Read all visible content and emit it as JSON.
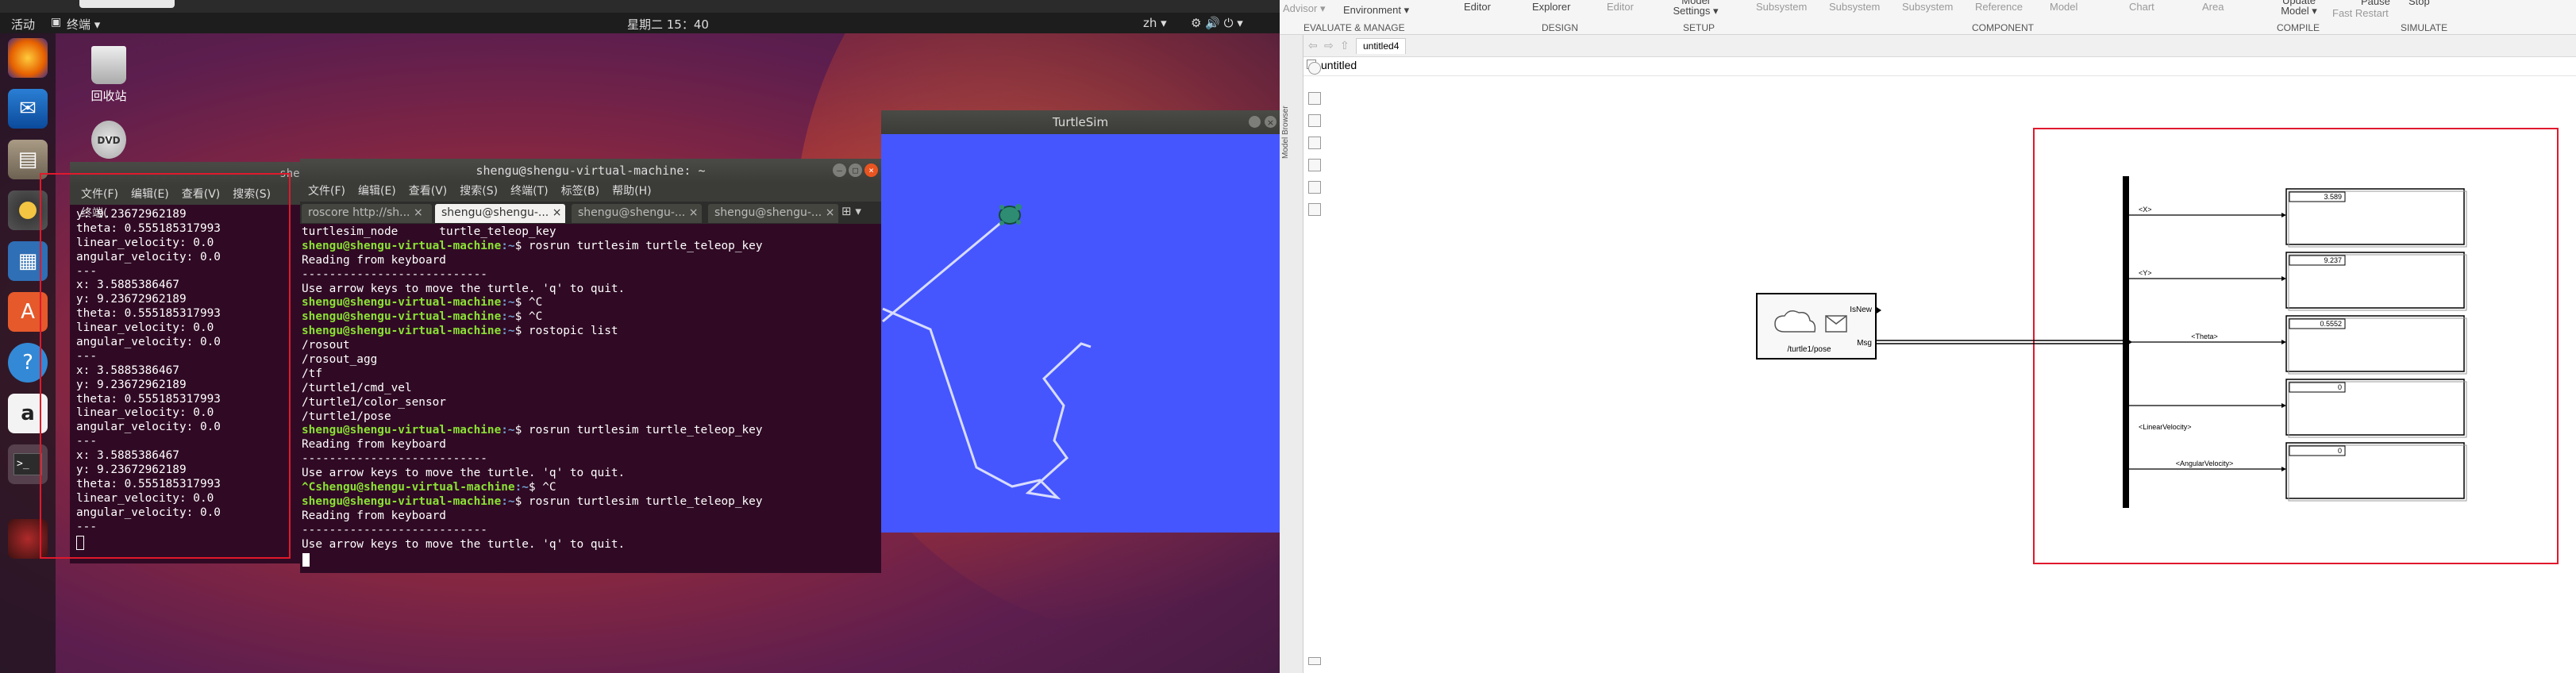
{
  "topbar": {
    "activities": "活动",
    "app_menu": "终端 ▾",
    "clock": "星期二 15：40",
    "input_method": "zh ▾",
    "system_icons": "⚙ 🔊 ⏻ ▾"
  },
  "desktop": {
    "trash_label": "回收站",
    "dvd_label": "DVD"
  },
  "dock": {
    "items": [
      "firefox-icon",
      "thunderbird-icon",
      "files-icon",
      "rhythmbox-icon",
      "writer-icon",
      "software-icon",
      "help-icon",
      "amazon-icon",
      "terminal-icon",
      "ros-icon"
    ]
  },
  "term_back": {
    "title_fragment": "shen",
    "menu": [
      "文件(F)",
      "编辑(E)",
      "查看(V)",
      "搜索(S)",
      "终端("
    ],
    "lines": [
      "y: 9.23672962189",
      "theta: 0.555185317993",
      "linear_velocity: 0.0",
      "angular_velocity: 0.0",
      "---",
      "x: 3.5885386467",
      "y: 9.23672962189",
      "theta: 0.555185317993",
      "linear_velocity: 0.0",
      "angular_velocity: 0.0",
      "---",
      "x: 3.5885386467",
      "y: 9.23672962189",
      "theta: 0.555185317993",
      "linear_velocity: 0.0",
      "angular_velocity: 0.0",
      "---",
      "x: 3.5885386467",
      "y: 9.23672962189",
      "theta: 0.555185317993",
      "linear_velocity: 0.0",
      "angular_velocity: 0.0",
      "---"
    ]
  },
  "term_front": {
    "title": "shengu@shengu-virtual-machine: ~",
    "menu": [
      "文件(F)",
      "编辑(E)",
      "查看(V)",
      "搜索(S)",
      "终端(T)",
      "标签(B)",
      "帮助(H)"
    ],
    "tabs": [
      "roscore http://sh...",
      "shengu@shengu-...",
      "shengu@shengu-...",
      "shengu@shengu-..."
    ],
    "prompt_user": "shengu@shengu-virtual-machine",
    "lines": [
      {
        "p": "",
        "t": "turtlesim_node      turtle_teleop_key"
      },
      {
        "p": "shengu@shengu-virtual-machine",
        "t": ":~$ rosrun turtlesim turtle_teleop_key"
      },
      {
        "p": "",
        "t": "Reading from keyboard"
      },
      {
        "p": "",
        "t": "---------------------------"
      },
      {
        "p": "",
        "t": "Use arrow keys to move the turtle. 'q' to quit."
      },
      {
        "p": "shengu@shengu-virtual-machine",
        "t": ":~$ ^C"
      },
      {
        "p": "shengu@shengu-virtual-machine",
        "t": ":~$ ^C"
      },
      {
        "p": "shengu@shengu-virtual-machine",
        "t": ":~$ rostopic list"
      },
      {
        "p": "",
        "t": "/rosout"
      },
      {
        "p": "",
        "t": "/rosout_agg"
      },
      {
        "p": "",
        "t": "/tf"
      },
      {
        "p": "",
        "t": "/turtle1/cmd_vel"
      },
      {
        "p": "",
        "t": "/turtle1/color_sensor"
      },
      {
        "p": "",
        "t": "/turtle1/pose"
      },
      {
        "p": "shengu@shengu-virtual-machine",
        "t": ":~$ rosrun turtlesim turtle_teleop_key"
      },
      {
        "p": "",
        "t": "Reading from keyboard"
      },
      {
        "p": "",
        "t": "---------------------------"
      },
      {
        "p": "",
        "t": "Use arrow keys to move the turtle. 'q' to quit."
      },
      {
        "p": "^Cshengu@shengu-virtual-machine",
        "t": ":~$ ^C"
      },
      {
        "p": "shengu@shengu-virtual-machine",
        "t": ":~$ rosrun turtlesim turtle_teleop_key"
      },
      {
        "p": "",
        "t": "Reading from keyboard"
      },
      {
        "p": "",
        "t": "---------------------------"
      },
      {
        "p": "",
        "t": "Use arrow keys to move the turtle. 'q' to quit."
      }
    ]
  },
  "turtlesim": {
    "title": "TurtleSim",
    "background": "#4556ff"
  },
  "matlab": {
    "toolstrip": {
      "advisor": "Advisor ▾",
      "environment": "Environment ▾",
      "editor": "Editor",
      "explorer": "Explorer",
      "editor2": "Editor",
      "model_settings": "Model Settings ▾",
      "subsystem1": "Subsystem",
      "subsystem2": "Subsystem",
      "subsystem3": "Subsystem",
      "reference": "Reference",
      "model": "Model",
      "chart": "Chart",
      "area": "Area",
      "update_model": "Update Model ▾",
      "pause": "Pause",
      "stop": "Stop",
      "fast_restart": "Fast Restart"
    },
    "sections": [
      "EVALUATE & MANAGE",
      "DESIGN",
      "SETUP",
      "COMPONENT",
      "COMPILE",
      "SIMULATE"
    ],
    "tab_name": "untitled4",
    "breadcrumb": "untitled",
    "model_browser": "Model Browser",
    "block_subscribe": {
      "topic": "/turtle1/pose",
      "port_isnew": "IsNew",
      "port_msg": "Msg"
    },
    "bus_signals": [
      "<X>",
      "<Y>",
      "<Theta>",
      "<LinearVelocity>",
      "<AngularVelocity>"
    ],
    "displays": [
      "3.589",
      "9.237",
      "0.5552",
      "0",
      "0"
    ]
  }
}
